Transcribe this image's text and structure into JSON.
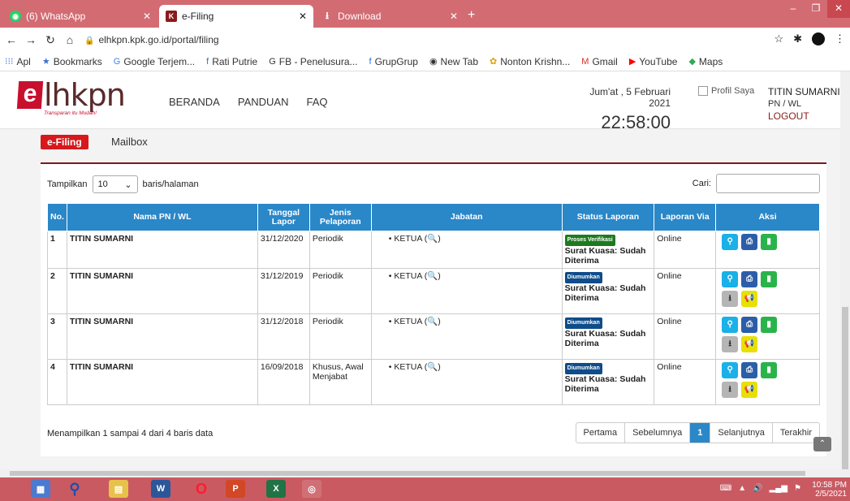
{
  "browser": {
    "tabs": [
      {
        "label": "(6) WhatsApp",
        "active": false
      },
      {
        "label": "e-Filing",
        "active": true
      },
      {
        "label": "Download",
        "active": false
      }
    ],
    "url": "elhkpn.kpk.go.id/portal/filing",
    "bookmarks": [
      "Apl",
      "Bookmarks",
      "Google Terjem...",
      "Rati Putrie",
      "FB - Penelusura...",
      "GrupGrup",
      "New Tab",
      "Nonton Krishn...",
      "Gmail",
      "YouTube",
      "Maps"
    ]
  },
  "site": {
    "logo_main": "lhkpn",
    "logo_e": "e",
    "tagline": "Transparan itu Mudah!",
    "nav": [
      "BERANDA",
      "PANDUAN",
      "FAQ"
    ],
    "date": "Jum'at , 5 Februari 2021",
    "time": "22:58:00",
    "profil_alt": "Profil Saya",
    "user_name": "TITIN SUMARNI",
    "user_role": "PN / WL",
    "logout": "LOGOUT",
    "subnav_active": "e-Filing",
    "subnav_mailbox": "Mailbox"
  },
  "table_tools": {
    "show_label": "Tampilkan",
    "page_size": "10",
    "per_page_label": "baris/halaman",
    "search_label": "Cari:"
  },
  "table": {
    "headers": [
      "No.",
      "Nama PN / WL",
      "Tanggal Lapor",
      "Jenis Pelaporan",
      "Jabatan",
      "Status Laporan",
      "Laporan Via",
      "Aksi"
    ],
    "rows": [
      {
        "no": "1",
        "nama": "TITIN SUMARNI",
        "tanggal": "31/12/2020",
        "jenis": "Periodik",
        "jabatan": "KETUA (🔍)",
        "badge": "Proses Verifikasi",
        "badge_color": "#1f7a1f",
        "status": "Surat Kuasa: Sudah Diterima",
        "via": "Online",
        "extra_buttons": false
      },
      {
        "no": "2",
        "nama": "TITIN SUMARNI",
        "tanggal": "31/12/2019",
        "jenis": "Periodik",
        "jabatan": "KETUA (🔍)",
        "badge": "Diumumkan",
        "badge_color": "#0f4c8a",
        "status": "Surat Kuasa: Sudah Diterima",
        "via": "Online",
        "extra_buttons": true
      },
      {
        "no": "3",
        "nama": "TITIN SUMARNI",
        "tanggal": "31/12/2018",
        "jenis": "Periodik",
        "jabatan": "KETUA (🔍)",
        "badge": "Diumumkan",
        "badge_color": "#0f4c8a",
        "status": "Surat Kuasa: Sudah Diterima",
        "via": "Online",
        "extra_buttons": true
      },
      {
        "no": "4",
        "nama": "TITIN SUMARNI",
        "tanggal": "16/09/2018",
        "jenis": "Khusus, Awal Menjabat",
        "jabatan": "KETUA (🔍)",
        "badge": "Diumumkan",
        "badge_color": "#0f4c8a",
        "status": "Surat Kuasa: Sudah Diterima",
        "via": "Online",
        "extra_buttons": true
      }
    ]
  },
  "footer": {
    "info": "Menampilkan 1 sampai 4 dari 4 baris data",
    "pager": [
      "Pertama",
      "Sebelumnya",
      "1",
      "Selanjutnya",
      "Terakhir"
    ]
  },
  "taskbar": {
    "time": "10:58 PM",
    "date": "2/5/2021"
  }
}
